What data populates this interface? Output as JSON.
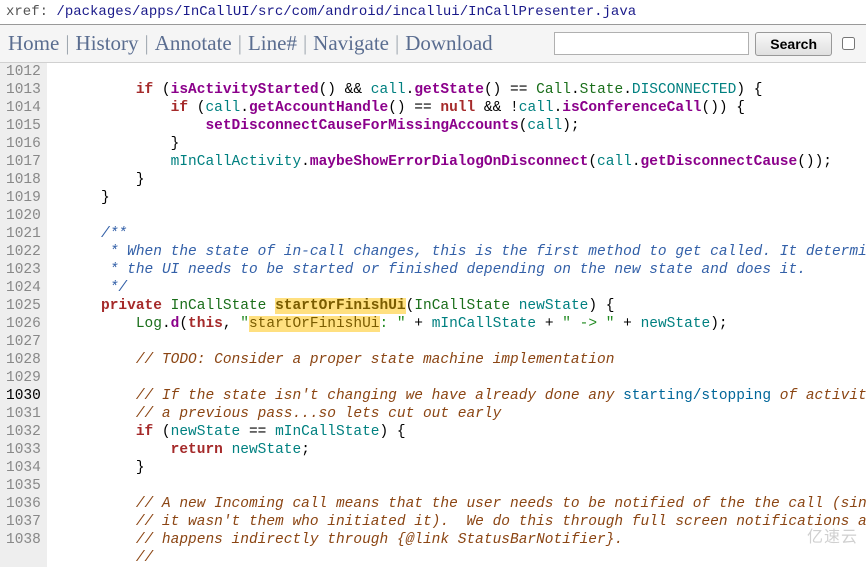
{
  "xref": {
    "label": "xref: ",
    "path": "/packages/apps/InCallUI/src/com/android/incallui/InCallPresenter.java"
  },
  "toolbar": {
    "home": "Home",
    "history": "History",
    "annotate": "Annotate",
    "line": "Line#",
    "navigate": "Navigate",
    "download": "Download",
    "search_placeholder": "",
    "search_btn": "Search"
  },
  "gutter": {
    "start": 1012,
    "end": 1038,
    "current": 1030
  },
  "code": {
    "l1012": {
      "kw_if": "if",
      "fn": "isActivityStarted",
      "var_call": "call",
      "fn_get": "getState",
      "cls_call": "Call",
      "cls_state": "State",
      "const": "DISCONNECTED"
    },
    "l1013": {
      "kw_if": "if",
      "var_call": "call",
      "fn_acc": "getAccountHandle",
      "kw_null": "null",
      "var_call2": "call",
      "fn_conf": "isConferenceCall"
    },
    "l1014": {
      "fn": "setDisconnectCauseForMissingAccounts",
      "var_call": "call"
    },
    "l1015": {
      "brace": "}"
    },
    "l1016": {
      "var_act": "mInCallActivity",
      "fn": "maybeShowErrorDialogOnDisconnect",
      "var_call": "call",
      "fn_cause": "getDisconnectCause"
    },
    "l1017": {
      "brace": "}"
    },
    "l1018": {
      "brace": "}"
    },
    "l1019": {
      "blank": ""
    },
    "l1020": {
      "jd": "/**"
    },
    "l1021": {
      "jd": " * When the state of in-call changes, this is the first method to get called. It determines if"
    },
    "l1022": {
      "jd": " * the UI needs to be started or finished depending on the new state and does it."
    },
    "l1023": {
      "jd": " */"
    },
    "l1024": {
      "kw_priv": "private",
      "cls": "InCallState",
      "hl": "startOrFinishUi",
      "cls2": "InCallState",
      "var": "newState"
    },
    "l1025": {
      "cls_log": "Log",
      "fn_d": "d",
      "kw_this": "this",
      "str1": "\"",
      "hl": "startOrFinishUi",
      "str2": ": \"",
      "var_m": "mInCallState",
      "str3": "\" -> \"",
      "var_n": "newState"
    },
    "l1026": {
      "blank": ""
    },
    "l1027": {
      "cmt": "// TODO: Consider a proper state machine implementation"
    },
    "l1028": {
      "blank": ""
    },
    "l1029": {
      "cmt1": "// If the state isn't changing we have already done any ",
      "lnk": "starting/stopping",
      "cmt2": " of activities in"
    },
    "l1030": {
      "cmt": "// a previous pass...so lets cut out early"
    },
    "l1031": {
      "kw_if": "if",
      "var_n": "newState",
      "var_m": "mInCallState"
    },
    "l1032": {
      "kw_ret": "return",
      "var_n": "newState"
    },
    "l1033": {
      "brace": "}"
    },
    "l1034": {
      "blank": ""
    },
    "l1035": {
      "cmt": "// A new Incoming call means that the user needs to be notified of the the call (since"
    },
    "l1036": {
      "cmt": "// it wasn't them who initiated it).  We do this through full screen notifications and"
    },
    "l1037": {
      "cmt": "// happens indirectly through {@link StatusBarNotifier}."
    },
    "l1038": {
      "cmt": "//"
    }
  },
  "watermark": "亿速云"
}
